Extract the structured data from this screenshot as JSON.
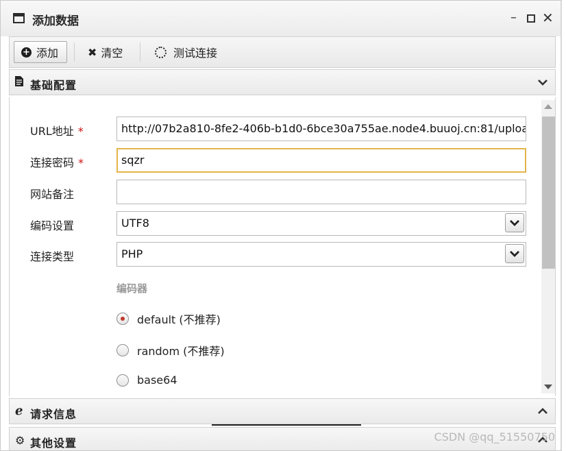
{
  "window": {
    "title": "添加数据",
    "controls": {
      "minimize": "–",
      "close": "✕"
    }
  },
  "toolbar": {
    "add_label": "添加",
    "clear_label": "清空",
    "test_label": "测试连接"
  },
  "sections": {
    "basic": {
      "title": "基础配置",
      "expanded": true
    },
    "request": {
      "title": "请求信息",
      "expanded": false
    },
    "other": {
      "title": "其他设置",
      "expanded": false
    }
  },
  "form": {
    "url": {
      "label": "URL地址",
      "required_mark": "*",
      "value": "http://07b2a810-8fe2-406b-b1d0-6bce30a755ae.node4.buuoj.cn:81/uploa"
    },
    "password": {
      "label": "连接密码",
      "required_mark": "*",
      "value": "sqzr"
    },
    "note": {
      "label": "网站备注",
      "value": ""
    },
    "encoding": {
      "label": "编码设置",
      "value": "UTF8"
    },
    "type": {
      "label": "连接类型",
      "value": "PHP"
    },
    "encoder": {
      "label": "编码器",
      "options": [
        {
          "label": "default (不推荐)",
          "checked": true
        },
        {
          "label": "random (不推荐)",
          "checked": false
        },
        {
          "label": "base64",
          "checked": false
        }
      ]
    }
  },
  "watermark": "CSDN @qq_51550750",
  "colors": {
    "focus_border": "#e3b44b",
    "required": "#d01010",
    "radio_dot": "#c0392b"
  }
}
